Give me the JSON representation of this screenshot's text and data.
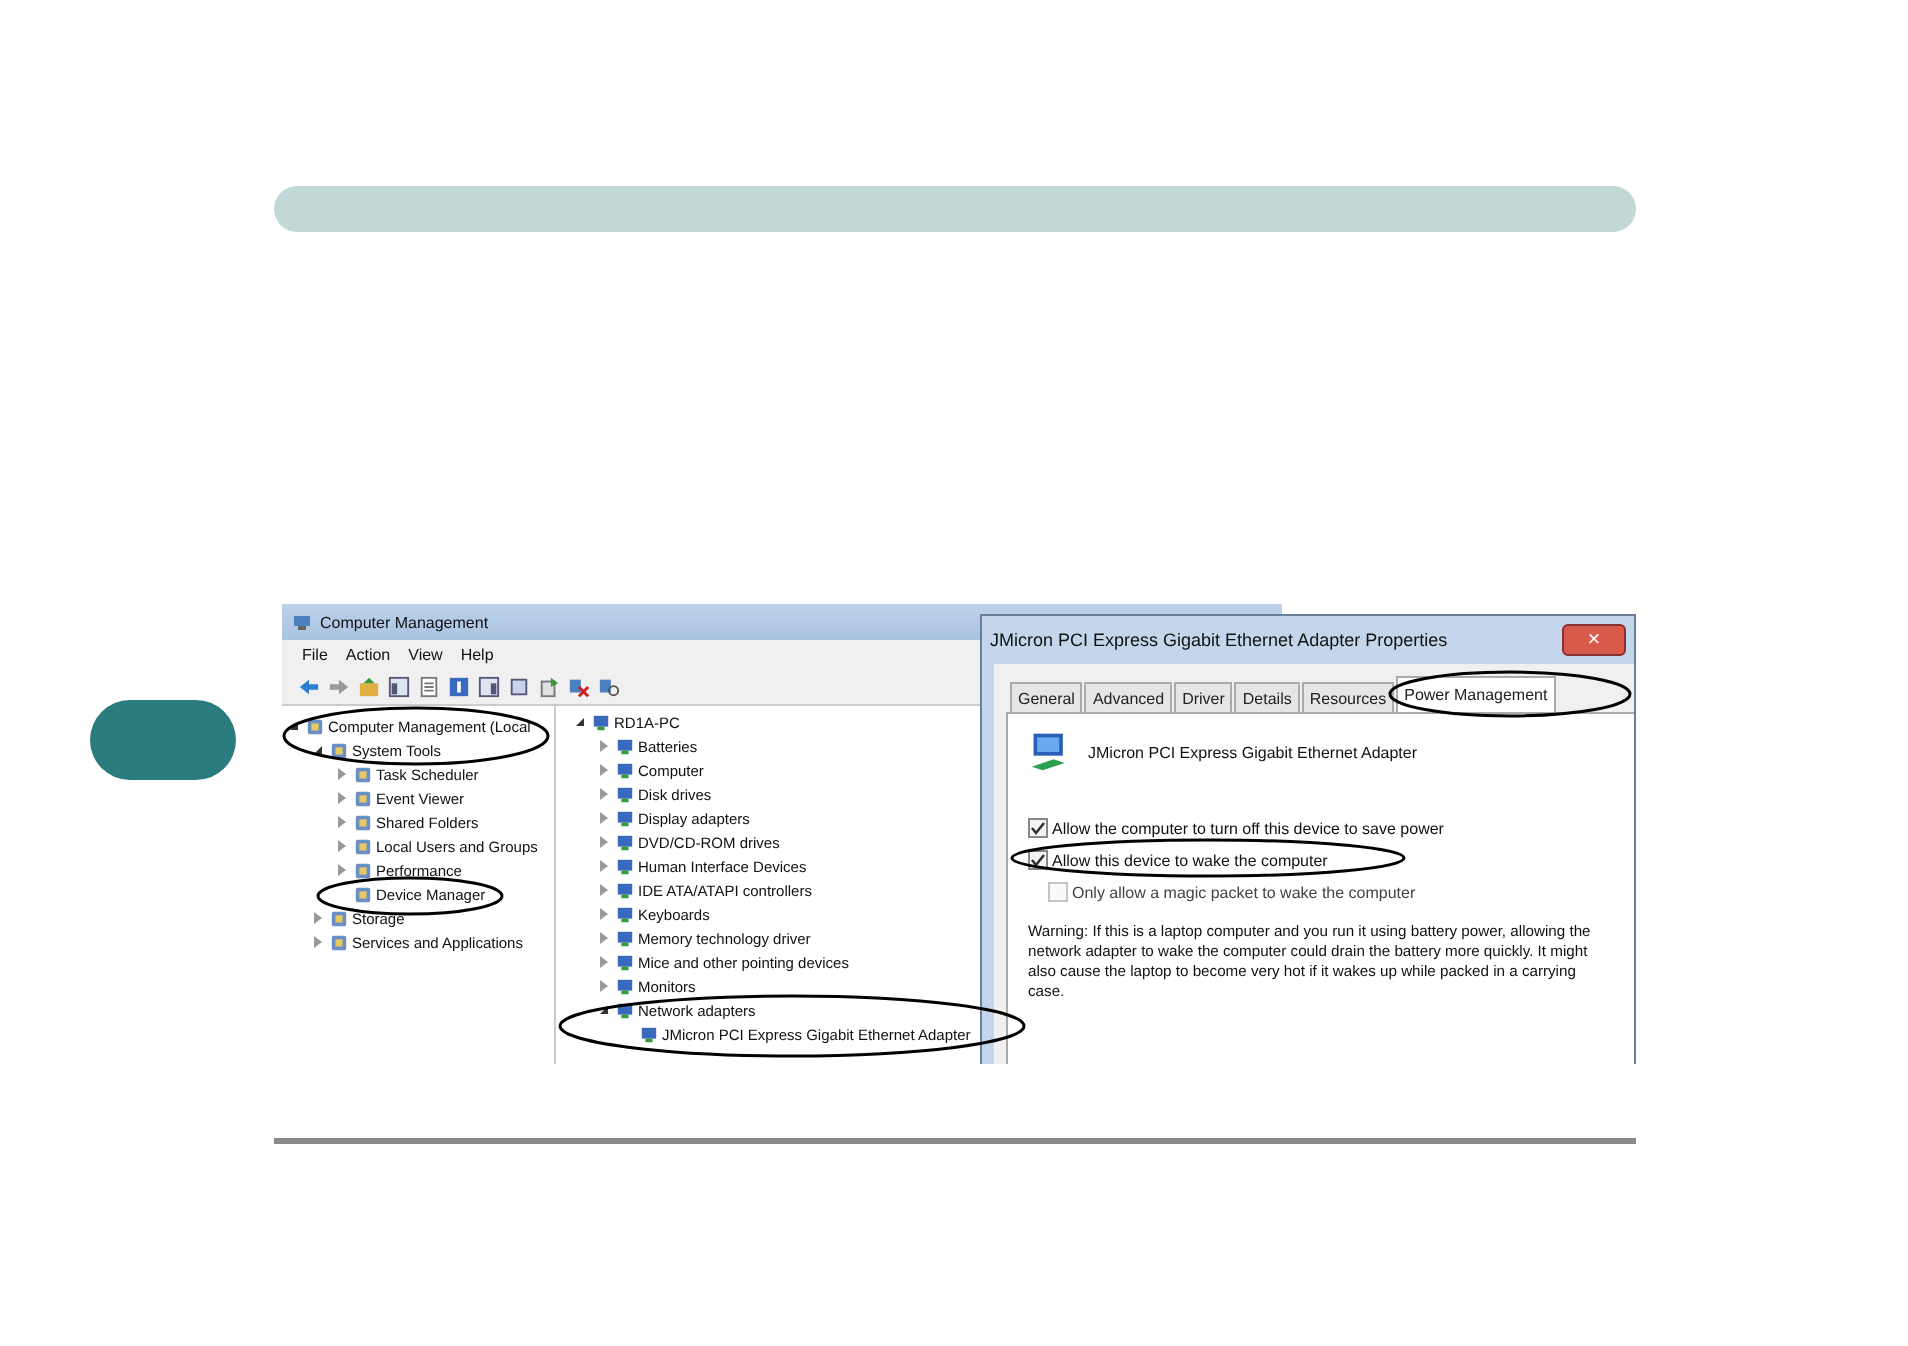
{
  "cm_window": {
    "title": "Computer Management",
    "menu": [
      "File",
      "Action",
      "View",
      "Help"
    ],
    "left_tree": [
      {
        "label": "Computer Management (Local",
        "expanded": true,
        "children": [
          {
            "label": "System Tools",
            "expanded": true,
            "children": [
              {
                "label": "Task Scheduler",
                "expanded": false
              },
              {
                "label": "Event Viewer",
                "expanded": false
              },
              {
                "label": "Shared Folders",
                "expanded": false
              },
              {
                "label": "Local Users and Groups",
                "expanded": false
              },
              {
                "label": "Performance",
                "expanded": false
              },
              {
                "label": "Device Manager"
              }
            ]
          },
          {
            "label": "Storage",
            "expanded": false
          },
          {
            "label": "Services and Applications",
            "expanded": false
          }
        ]
      }
    ],
    "right_tree": [
      {
        "label": "RD1A-PC",
        "expanded": true,
        "children": [
          {
            "label": "Batteries",
            "expanded": false
          },
          {
            "label": "Computer",
            "expanded": false
          },
          {
            "label": "Disk drives",
            "expanded": false
          },
          {
            "label": "Display adapters",
            "expanded": false
          },
          {
            "label": "DVD/CD-ROM drives",
            "expanded": false
          },
          {
            "label": "Human Interface Devices",
            "expanded": false
          },
          {
            "label": "IDE ATA/ATAPI controllers",
            "expanded": false
          },
          {
            "label": "Keyboards",
            "expanded": false
          },
          {
            "label": "Memory technology driver",
            "expanded": false
          },
          {
            "label": "Mice and other pointing devices",
            "expanded": false
          },
          {
            "label": "Monitors",
            "expanded": false
          },
          {
            "label": "Network adapters",
            "expanded": true,
            "children": [
              {
                "label": "JMicron PCI Express Gigabit Ethernet Adapter"
              }
            ]
          }
        ]
      }
    ]
  },
  "dialog": {
    "title": "JMicron PCI Express Gigabit Ethernet Adapter Properties",
    "close": "×",
    "tabs": [
      {
        "label": "General",
        "selected": false
      },
      {
        "label": "Advanced",
        "selected": false
      },
      {
        "label": "Driver",
        "selected": false
      },
      {
        "label": "Details",
        "selected": false
      },
      {
        "label": "Resources",
        "selected": false
      },
      {
        "label": "Power Management",
        "selected": true
      }
    ],
    "device_name": "JMicron PCI Express Gigabit Ethernet Adapter",
    "options": [
      {
        "label": "Allow the computer to turn off this device to save power",
        "checked": true,
        "disabled": false,
        "indented": false
      },
      {
        "label": "Allow this device to wake the computer",
        "checked": true,
        "disabled": false,
        "indented": false
      },
      {
        "label": "Only allow a magic packet to wake the computer",
        "checked": false,
        "disabled": true,
        "indented": true
      }
    ],
    "warning": "Warning: If this is a laptop computer and you run it using battery power, allowing the network adapter to wake the computer could drain the battery more quickly. It might also cause the laptop to become very hot if it wakes up while packed in a carrying case."
  }
}
